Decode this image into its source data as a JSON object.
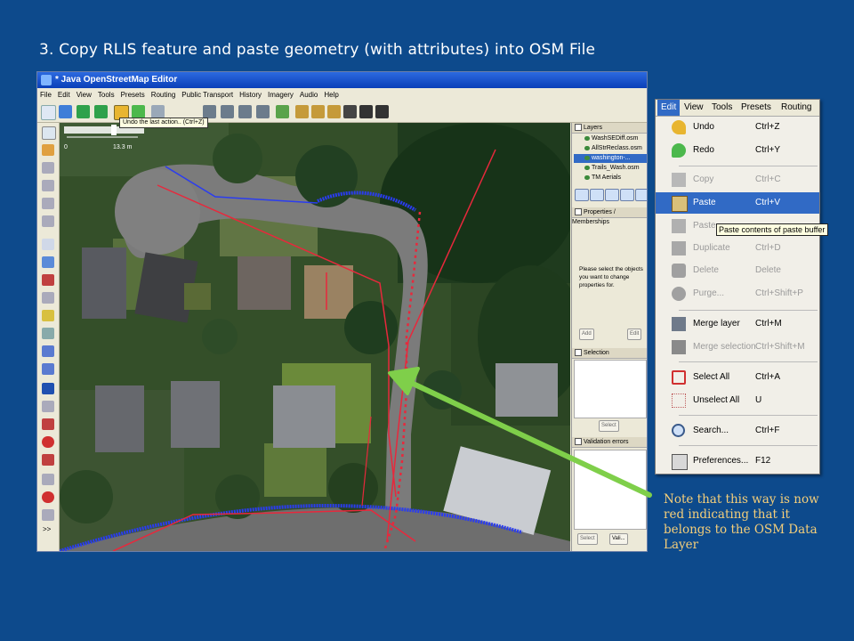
{
  "slide": {
    "title": "3.  Copy RLIS feature and paste geometry (with attributes) into OSM File",
    "note": "Note that this way is now red indicating that it belongs to the OSM Data Layer"
  },
  "josm": {
    "title": "* Java OpenStreetMap Editor",
    "menu": [
      "File",
      "Edit",
      "View",
      "Tools",
      "Presets",
      "Routing",
      "Public Transport",
      "History",
      "Imagery",
      "Audio",
      "Help"
    ],
    "undo_tooltip": "Undo the last action.. (Ctrl+Z)",
    "scale": {
      "start": "0",
      "end": "13.3 m"
    },
    "panels": {
      "layers_title": "Layers",
      "layers": [
        "WashSEDiff.osm",
        "AllStrReclass.osm",
        "washington-...",
        "Trails_Wash.osm",
        "TM Aerials"
      ],
      "properties_title": "Properties / Memberships",
      "properties_hint": "Please select the objects you want to change properties for.",
      "add_label": "Add",
      "edit_label": "Edit",
      "selection_title": "Selection",
      "select_label": "Select",
      "validation_title": "Validation errors",
      "select2_label": "Select",
      "validate_label": "Vali..."
    }
  },
  "edit_menu": {
    "bar": [
      "Edit",
      "View",
      "Tools",
      "Presets",
      "Routing"
    ],
    "items": [
      {
        "label": "Undo",
        "shortcut": "Ctrl+Z",
        "state": "enabled",
        "icon": "undo-icon"
      },
      {
        "label": "Redo",
        "shortcut": "Ctrl+Y",
        "state": "enabled",
        "icon": "redo-icon"
      },
      {
        "label": "Copy",
        "shortcut": "Ctrl+C",
        "state": "disabled",
        "icon": "copy-icon"
      },
      {
        "label": "Paste",
        "shortcut": "Ctrl+V",
        "state": "selected",
        "icon": "paste-icon"
      },
      {
        "label": "Paste",
        "shortcut": "",
        "state": "disabled",
        "icon": "paste-tags-icon"
      },
      {
        "label": "Duplicate",
        "shortcut": "Ctrl+D",
        "state": "disabled",
        "icon": "duplicate-icon"
      },
      {
        "label": "Delete",
        "shortcut": "Delete",
        "state": "disabled",
        "icon": "delete-icon"
      },
      {
        "label": "Purge...",
        "shortcut": "Ctrl+Shift+P",
        "state": "disabled",
        "icon": "purge-icon"
      },
      {
        "label": "Merge layer",
        "shortcut": "Ctrl+M",
        "state": "enabled",
        "icon": "merge-layer-icon"
      },
      {
        "label": "Merge selection",
        "shortcut": "Ctrl+Shift+M",
        "state": "disabled",
        "icon": "merge-selection-icon"
      },
      {
        "label": "Select All",
        "shortcut": "Ctrl+A",
        "state": "enabled",
        "icon": "select-all-icon"
      },
      {
        "label": "Unselect All",
        "shortcut": "U",
        "state": "enabled",
        "icon": "unselect-all-icon"
      },
      {
        "label": "Search...",
        "shortcut": "Ctrl+F",
        "state": "enabled",
        "icon": "search-icon"
      },
      {
        "label": "Preferences...",
        "shortcut": "F12",
        "state": "enabled",
        "icon": "preferences-icon"
      }
    ],
    "paste_tooltip": "Paste contents of paste buffer"
  },
  "colors": {
    "background": "#0d4a8c",
    "note_text": "#f4ce7a",
    "osm_way": "#e8283c",
    "rlis_way": "#2a3cf0",
    "arrow": "#7fcf4a",
    "menu_highlight": "#316ac5"
  }
}
